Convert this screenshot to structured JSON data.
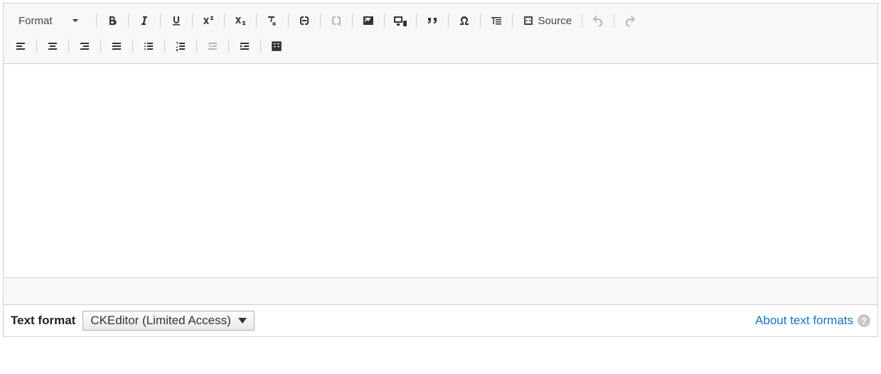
{
  "toolbar": {
    "format_label": "Format",
    "source_label": "Source"
  },
  "footer": {
    "label": "Text format",
    "select_value": "CKEditor (Limited Access)",
    "about_label": "About text formats",
    "help_char": "?"
  },
  "icons": {
    "bold": "bold-icon",
    "italic": "italic-icon",
    "underline": "underline-icon",
    "superscript": "superscript-icon",
    "subscript": "subscript-icon",
    "remove_format": "remove-format-icon",
    "link": "link-icon",
    "unlink": "unlink-icon",
    "image": "image-icon",
    "media": "media-icon",
    "blockquote": "blockquote-icon",
    "specialchar": "special-char-icon",
    "show_blocks": "show-blocks-icon",
    "source": "source-icon",
    "undo": "undo-icon",
    "redo": "redo-icon",
    "align_left": "align-left-icon",
    "align_center": "align-center-icon",
    "align_right": "align-right-icon",
    "justify": "justify-icon",
    "ul": "bulleted-list-icon",
    "ol": "numbered-list-icon",
    "outdent": "outdent-icon",
    "indent": "indent-icon",
    "table": "table-icon"
  }
}
